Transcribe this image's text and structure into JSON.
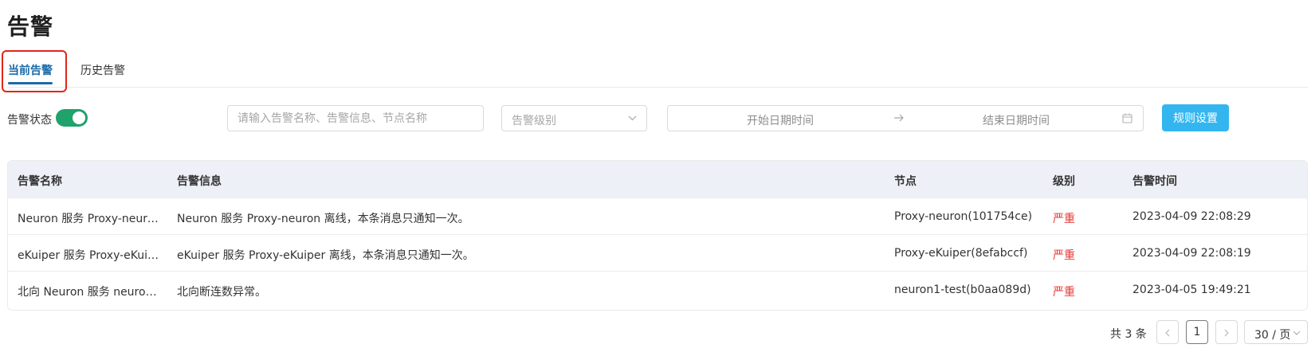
{
  "page": {
    "title": "告警"
  },
  "tabs": [
    {
      "label": "当前告警",
      "active": true
    },
    {
      "label": "历史告警",
      "active": false
    }
  ],
  "filters": {
    "status_label": "告警状态",
    "status_on": true,
    "search_placeholder": "请输入告警名称、告警信息、节点名称",
    "level_placeholder": "告警级别",
    "start_placeholder": "开始日期时间",
    "end_placeholder": "结束日期时间",
    "rules_button": "规则设置"
  },
  "table": {
    "headers": [
      "告警名称",
      "告警信息",
      "节点",
      "级别",
      "告警时间"
    ],
    "rows": [
      {
        "name": "Neuron 服务 Proxy-neuro...",
        "info": "Neuron 服务 Proxy-neuron 离线，本条消息只通知一次。",
        "node": "Proxy-neuron(101754ce)",
        "level": "严重",
        "time": "2023-04-09 22:08:29"
      },
      {
        "name": "eKuiper 服务 Proxy-eKuip...",
        "info": "eKuiper 服务 Proxy-eKuiper 离线，本条消息只通知一次。",
        "node": "Proxy-eKuiper(8efabccf)",
        "level": "严重",
        "time": "2023-04-09 22:08:19"
      },
      {
        "name": "北向 Neuron 服务 neuron...",
        "info": "北向断连数异常。",
        "node": "neuron1-test(b0aa089d)",
        "level": "严重",
        "time": "2023-04-05 19:49:21"
      }
    ]
  },
  "pagination": {
    "total": "共 3 条",
    "current_page": "1",
    "page_size": "30 / 页"
  },
  "colors": {
    "accent": "#1a6aa8",
    "toggle_on": "#1fa26c",
    "button": "#33b6f0",
    "severe": "#e53935",
    "highlight_box": "#e0261b"
  }
}
